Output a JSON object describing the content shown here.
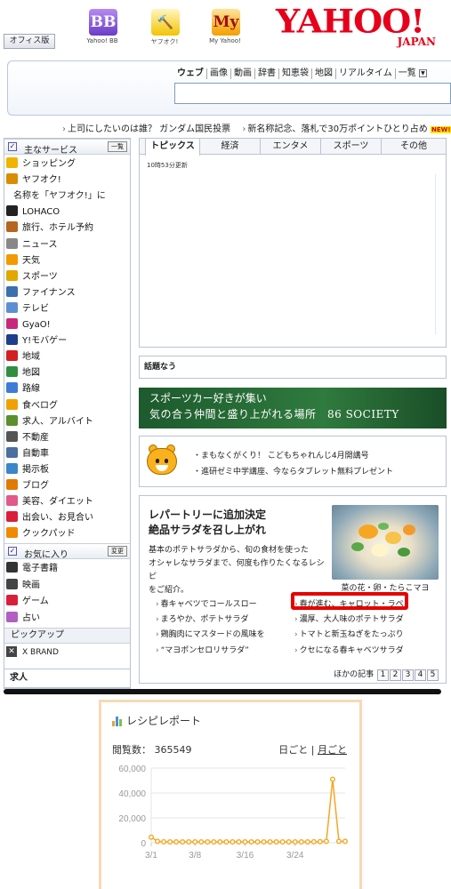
{
  "header": {
    "office_button": "オフィス版",
    "icons": [
      {
        "name": "yahoo-bb-icon",
        "glyph": "BB",
        "label": "Yahoo! BB",
        "color": "#7a4bd1"
      },
      {
        "name": "auction-icon",
        "glyph": "🔨",
        "label": "ヤフオク!",
        "color": "#f2c400"
      },
      {
        "name": "my-yahoo-icon",
        "glyph": "My",
        "label": "My Yahoo!",
        "color": "#f2a000"
      }
    ],
    "logo_main": "YAHOO!",
    "logo_sub": "JAPAN"
  },
  "search": {
    "tabs": [
      "ウェブ",
      "画像",
      "動画",
      "辞書",
      "知恵袋",
      "地図",
      "リアルタイム",
      "一覧"
    ],
    "query": ""
  },
  "ticker": {
    "item1": "上司にしたいのは誰？ ガンダム国民投票",
    "item2": "新名称記念、落札で30万ポイントひとり占め",
    "new_badge": "NEW!"
  },
  "sidebar": {
    "main_header": "主なサービス",
    "collapse_label": "一覧",
    "items": [
      {
        "label": "ショッピング",
        "icon": "shopping-bag-icon",
        "color": "#f0b400"
      },
      {
        "label": "ヤフオク!",
        "icon": "auction-icon",
        "color": "#d98c00"
      },
      {
        "label": "名称を「ヤフオク!」に",
        "icon": "",
        "color": ""
      },
      {
        "label": "LOHACO",
        "icon": "lohaco-icon",
        "color": "#222222"
      },
      {
        "label": "旅行、ホテル予約",
        "icon": "travel-icon",
        "color": "#b5651d"
      },
      {
        "label": "ニュース",
        "icon": "news-icon",
        "color": "#888888"
      },
      {
        "label": "天気",
        "icon": "weather-icon",
        "color": "#f29a00"
      },
      {
        "label": "スポーツ",
        "icon": "trophy-icon",
        "color": "#e0a800"
      },
      {
        "label": "ファイナンス",
        "icon": "finance-icon",
        "color": "#3a6fb0"
      },
      {
        "label": "テレビ",
        "icon": "tv-icon",
        "color": "#5c8fd0"
      },
      {
        "label": "GyaO!",
        "icon": "gyao-icon",
        "color": "#c8287a"
      },
      {
        "label": "Y!モバゲー",
        "icon": "mobage-icon",
        "color": "#1d3e8a"
      },
      {
        "label": "地域",
        "icon": "pin-icon",
        "color": "#d02020"
      },
      {
        "label": "地図",
        "icon": "globe-icon",
        "color": "#2f8f3f"
      },
      {
        "label": "路線",
        "icon": "train-icon",
        "color": "#3d7bd6"
      },
      {
        "label": "食べログ",
        "icon": "tabelog-icon",
        "color": "#f0a000"
      },
      {
        "label": "求人、アルバイト",
        "icon": "job-icon",
        "color": "#5a8f2f"
      },
      {
        "label": "不動産",
        "icon": "house-icon",
        "color": "#555555"
      },
      {
        "label": "自動車",
        "icon": "car-icon",
        "color": "#4a6fa0"
      },
      {
        "label": "掲示板",
        "icon": "board-icon",
        "color": "#3a86c8"
      },
      {
        "label": "ブログ",
        "icon": "blog-icon",
        "color": "#e07a00"
      },
      {
        "label": "美容、ダイエット",
        "icon": "beauty-icon",
        "color": "#e05a8a"
      },
      {
        "label": "出会い、お見合い",
        "icon": "heart-icon",
        "color": "#d8203a"
      },
      {
        "label": "クックパッド",
        "icon": "cookpad-icon",
        "color": "#f08a00"
      }
    ],
    "fav_header": "お気に入り",
    "fav_edit": "変更",
    "fav_items": [
      {
        "label": "電子書籍",
        "icon": "ebook-icon",
        "color": "#333333"
      },
      {
        "label": "映画",
        "icon": "movie-icon",
        "color": "#444444"
      },
      {
        "label": "ゲーム",
        "icon": "game-icon",
        "color": "#d8203a"
      },
      {
        "label": "占い",
        "icon": "fortune-icon",
        "color": "#b060c0"
      }
    ],
    "pickup": "ピックアップ",
    "xbrand": "X BRAND",
    "kyujin": "求人"
  },
  "topics": {
    "tabs": [
      "トピックス",
      "経済",
      "エンタメ",
      "スポーツ",
      "その他"
    ],
    "updated": "10時53分更新"
  },
  "wadai": "話題なう",
  "banner": {
    "line1": "スポーツカー好きが集い",
    "line2": "気の合う仲間と盛り上がれる場所　86 SOCIETY"
  },
  "shimajiro": {
    "line1": "・まもなくがくり！ こどもちゃれんじ4月開講号",
    "line2": "・進研ゼミ中学講座、今ならタブレット無料プレゼント"
  },
  "feature": {
    "title1": "レパートリーに追加決定",
    "title2": "絶品サラダを召し上がれ",
    "body1": "基本のポテトサラダから、旬の食材を使った",
    "body2": "オシャレなサラダまで、何度も作りたくなるレシピ",
    "body3": "をご紹介。",
    "photo_caption": "菜の花・卵・たらこマヨ",
    "links_left": [
      "春キャベツでコールスロー",
      "まろやか、ポテトサラダ",
      "鶏胸肉にマスタードの風味を",
      "“マヨポンセロリサラダ”"
    ],
    "links_right": [
      "春が進む、キャロット・ラペ",
      "濃厚、大人味のポテトサラダ",
      "トマトと新玉ねぎをたっぷり",
      "クセになる春キャベツサラダ"
    ],
    "more_label": "ほかの記事",
    "pages": [
      "1",
      "2",
      "3",
      "4",
      "5"
    ]
  },
  "report": {
    "title": "レシピレポート",
    "views_label": "閲覧数：",
    "views_value": "365549",
    "mode_daily": "日ごと",
    "mode_sep": " | ",
    "mode_monthly": "月ごと",
    "accent": "#f0a030"
  },
  "chart_data": {
    "type": "line",
    "title": "",
    "xlabel": "",
    "ylabel": "",
    "ylim": [
      0,
      60000
    ],
    "yticks": [
      "60,000",
      "40,000",
      "20,000",
      "0"
    ],
    "xtick_labels": [
      "3/1",
      "3/8",
      "3/16",
      "3/24"
    ],
    "grid": true,
    "series": [
      {
        "color": "#f5a623",
        "values": [
          4500,
          1200,
          800,
          700,
          700,
          700,
          700,
          700,
          700,
          700,
          700,
          700,
          700,
          700,
          700,
          700,
          700,
          700,
          700,
          700,
          700,
          700,
          700,
          700,
          700,
          700,
          800,
          900,
          1200,
          51000,
          1200,
          1200
        ]
      }
    ]
  }
}
